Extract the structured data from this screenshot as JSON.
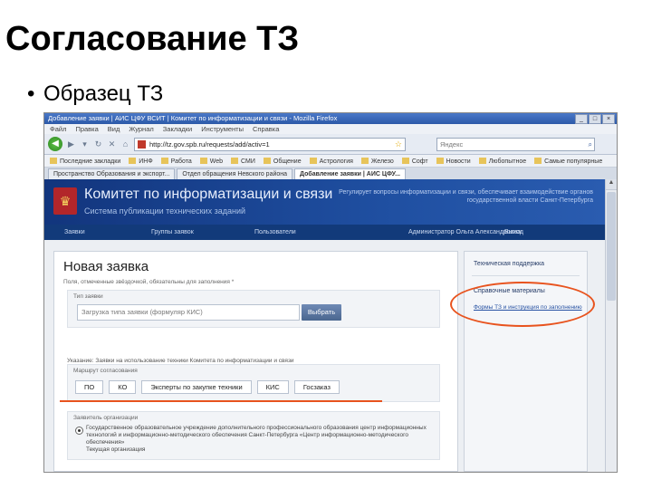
{
  "slide": {
    "title": "Согласование ТЗ",
    "bullet": "Образец ТЗ"
  },
  "browser": {
    "window_title": "Добавление заявки | АИС ЦФУ ВСИТ | Комитет по информатизации и связи - Mozilla Firefox",
    "window_buttons": [
      "_",
      "□",
      "×"
    ],
    "menu": [
      "Файл",
      "Правка",
      "Вид",
      "Журнал",
      "Закладки",
      "Инструменты",
      "Справка"
    ],
    "address": "http://tz.gov.spb.ru/requests/add/activ=1",
    "search_placeholder": "Яндекс",
    "bookmarks": [
      "Последние закладки",
      "ИНФ",
      "Работа",
      "Web",
      "СМИ",
      "Общение",
      "Астрология",
      "Железо",
      "Софт",
      "Новости",
      "Любопытное",
      "Самые популярные"
    ],
    "tabs": [
      "Пространство Образования и экспорт...",
      "Отдел обращения Невского района",
      "Добавление заявки | АИС ЦФУ..."
    ],
    "active_tab_index": 2
  },
  "site": {
    "title": "Комитет по информатизации и связи",
    "subtitle": "Система публикации технических заданий",
    "banner_note": "Регулирует вопросы информатизации и связи, обеспечивает взаимодействие органов государственной власти Санкт-Петербурга",
    "nav": [
      "Заявки",
      "Группы заявок",
      "Пользователи",
      "Выход"
    ],
    "user": "Администратор Ольга Александровна"
  },
  "form": {
    "heading": "Новая заявка",
    "required_note": "Поля, отмеченные звёздочкой, обязательны для заполнения *",
    "section1_label": "Тип заявки",
    "choose_placeholder": "Загрузка типа заявки (формуляр КИС)",
    "choose_button": "Выбрать",
    "hint": "Указание: Заявки на использование техники Комитета по информатизации и связи",
    "section2_label": "Маршрут согласования",
    "route": [
      "ПО",
      "КО",
      "Эксперты по закупке техники",
      "КИС",
      "Госзаказ"
    ],
    "section3_label": "Заявитель организации",
    "radio_text": "Государственное образовательное учреждение дополнительного профессионального образования центр информационных технологий и информационно-методического обеспечения Санкт-Петербурга «Центр информационно-методического обеспечения»",
    "radio_text2": "Текущая организация"
  },
  "sidebar": {
    "support": "Техническая поддержка",
    "materials": "Справочные материалы",
    "link": "Формы ТЗ и инструкция по заполнению"
  },
  "colors": {
    "highlight": "#e8531e",
    "banner": "#1f4fa1"
  }
}
